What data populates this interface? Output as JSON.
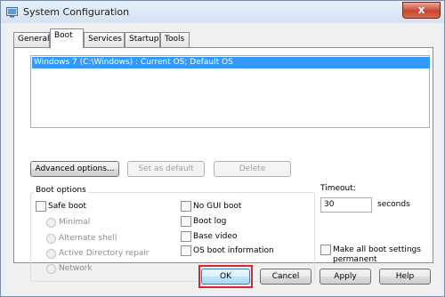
{
  "window": {
    "title": "System Configuration",
    "close_glyph": "x"
  },
  "tabs": [
    {
      "label": "General"
    },
    {
      "label": "Boot"
    },
    {
      "label": "Services"
    },
    {
      "label": "Startup"
    },
    {
      "label": "Tools"
    }
  ],
  "os_list": {
    "items": [
      "Windows 7 (C:\\Windows) : Current OS; Default OS"
    ]
  },
  "buttons": {
    "advanced": "Advanced options...",
    "set_default": "Set as default",
    "delete": "Delete",
    "ok": "OK",
    "cancel": "Cancel",
    "apply": "Apply",
    "help": "Help"
  },
  "boot_options": {
    "group_label": "Boot options",
    "safe_boot": "Safe boot",
    "minimal": "Minimal",
    "alternate_shell": "Alternate shell",
    "active_directory_repair": "Active Directory repair",
    "network": "Network",
    "no_gui_boot": "No GUI boot",
    "boot_log": "Boot log",
    "base_video": "Base video",
    "os_boot_info": "OS boot information"
  },
  "timeout": {
    "label": "Timeout:",
    "value": "30",
    "unit": "seconds"
  },
  "make_permanent": {
    "line1": "Make all boot settings",
    "line2": "permanent"
  }
}
